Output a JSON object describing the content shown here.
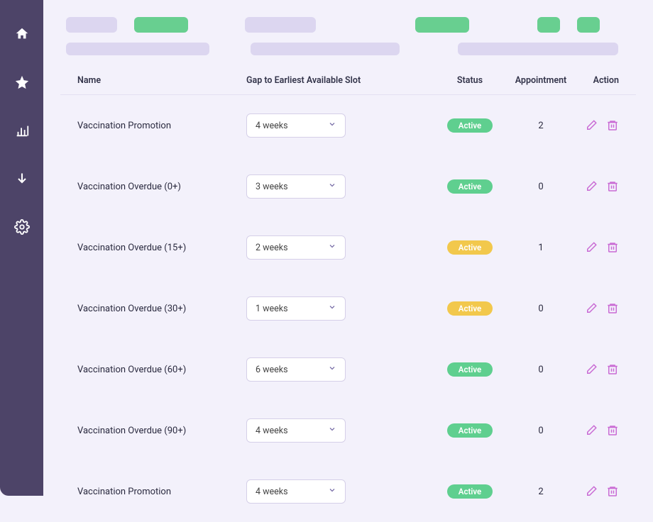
{
  "sidebar": {
    "items": [
      {
        "name": "home-icon"
      },
      {
        "name": "star-icon"
      },
      {
        "name": "chart-icon"
      },
      {
        "name": "download-icon"
      },
      {
        "name": "settings-icon"
      }
    ]
  },
  "table": {
    "headers": {
      "name": "Name",
      "gap": "Gap to Earliest Available Slot",
      "status": "Status",
      "appointment": "Appointment",
      "action": "Action"
    },
    "rows": [
      {
        "name": "Vaccination Promotion",
        "gap": "4 weeks",
        "status": "Active",
        "status_color": "green",
        "appointment": "2"
      },
      {
        "name": "Vaccination Overdue (0+)",
        "gap": "3 weeks",
        "status": "Active",
        "status_color": "green",
        "appointment": "0"
      },
      {
        "name": "Vaccination Overdue (15+)",
        "gap": "2 weeks",
        "status": "Active",
        "status_color": "yellow",
        "appointment": "1"
      },
      {
        "name": "Vaccination Overdue (30+)",
        "gap": "1 weeks",
        "status": "Active",
        "status_color": "yellow",
        "appointment": "0"
      },
      {
        "name": "Vaccination Overdue (60+)",
        "gap": "6 weeks",
        "status": "Active",
        "status_color": "green",
        "appointment": "0"
      },
      {
        "name": "Vaccination Overdue (90+)",
        "gap": "4 weeks",
        "status": "Active",
        "status_color": "green",
        "appointment": "0"
      },
      {
        "name": "Vaccination Promotion",
        "gap": "4 weeks",
        "status": "Active",
        "status_color": "green",
        "appointment": "2"
      }
    ]
  }
}
